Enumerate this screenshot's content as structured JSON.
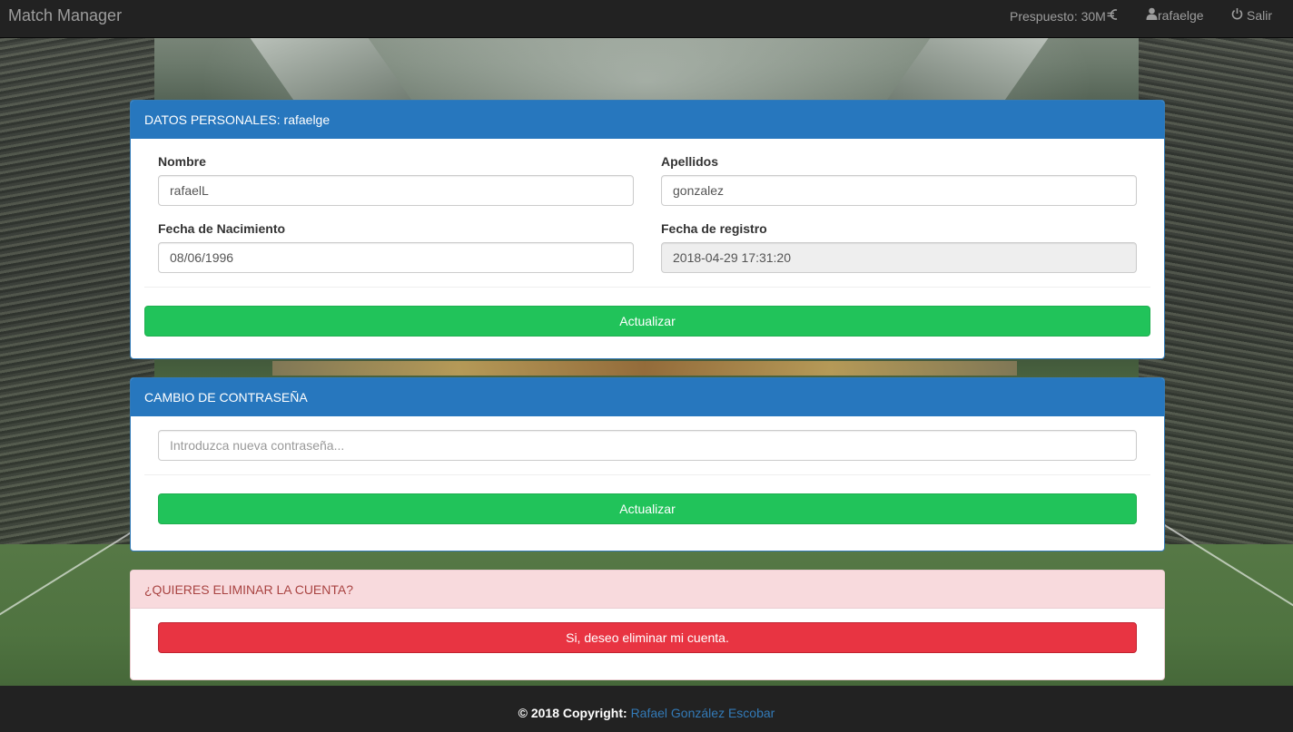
{
  "navbar": {
    "brand": "Match Manager",
    "budget": "Prespuesto: 30M",
    "user": "rafaelge",
    "logout": "Salir"
  },
  "personal": {
    "heading": "DATOS PERSONALES: rafaelge",
    "nombre_label": "Nombre",
    "nombre_value": "rafaelL",
    "apellidos_label": "Apellidos",
    "apellidos_value": "gonzalez",
    "fecha_nac_label": "Fecha de Nacimiento",
    "fecha_nac_value": "08/06/1996",
    "fecha_reg_label": "Fecha de registro",
    "fecha_reg_value": "2018-04-29 17:31:20",
    "update_button": "Actualizar"
  },
  "password": {
    "heading": "CAMBIO DE CONTRASEÑA",
    "placeholder": "Introduzca nueva contraseña...",
    "update_button": "Actualizar"
  },
  "delete": {
    "heading": "¿QUIERES ELIMINAR LA CUENTA?",
    "button": "Si, deseo eliminar mi cuenta."
  },
  "footer": {
    "copyright": "© 2018 Copyright:",
    "author": "Rafael González Escobar"
  },
  "colors": {
    "primary_heading": "#2777be",
    "success": "#21c35a",
    "danger": "#e83442",
    "danger_heading_bg": "#f8dadd"
  },
  "icons": {
    "budget": "euro-icon",
    "user": "user-icon",
    "logout": "power-icon"
  }
}
